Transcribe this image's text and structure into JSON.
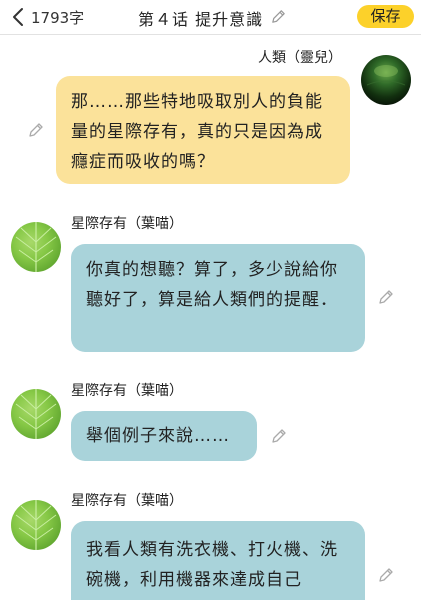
{
  "header": {
    "char_count": "1793字",
    "chapter_title": "第４话 提升意識",
    "save_label": "保存"
  },
  "messages": [
    {
      "speaker": "人類（靈兒）",
      "text": "那……那些特地吸取別人的負能量的星際存有，真的只是因為成癮症而吸收的嗎？"
    },
    {
      "speaker": "星際存有（葉喵）",
      "text": "你真的想聽？算了，多少說給你聽好了，算是給人類們的提醒．"
    },
    {
      "speaker": "星際存有（葉喵）",
      "text": "舉個例子來說……"
    },
    {
      "speaker": "星際存有（葉喵）",
      "text": "我看人類有洗衣機、打火機、洗碗機，利用機器來達成自己"
    }
  ],
  "colors": {
    "accent_yellow": "#fcd12a",
    "bubble_yellow": "#fbe29a",
    "bubble_blue": "#a9d3da"
  },
  "icons": [
    "chevron-left-icon",
    "pencil-icon",
    "avatar-dark-orb",
    "avatar-green-leaf"
  ]
}
